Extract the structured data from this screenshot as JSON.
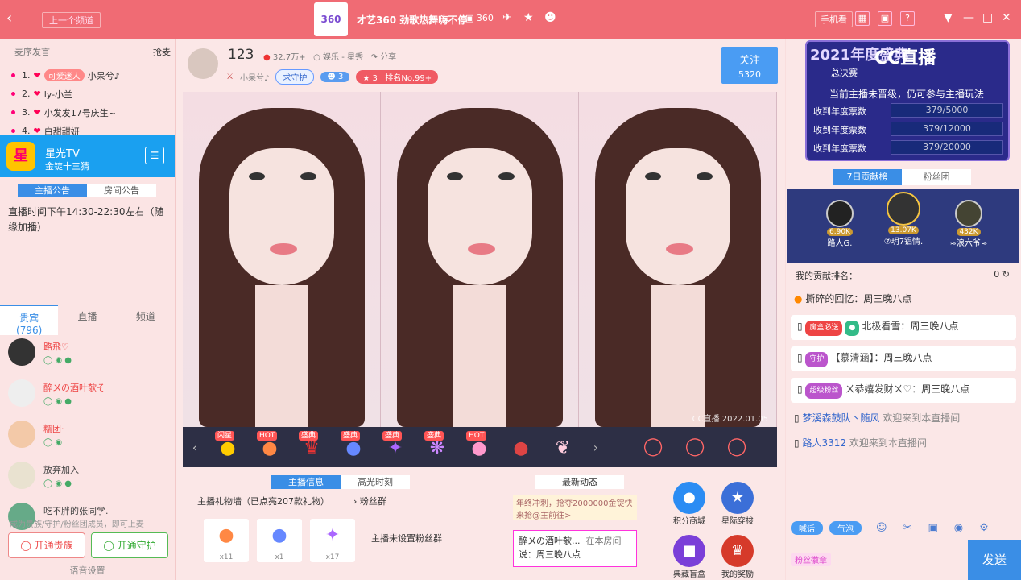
{
  "titlebar": {
    "prev_channel": "上一个频道",
    "logo_text": "360",
    "room_name": "才艺360 劲歌热舞嗨不停",
    "viewers": "360",
    "mobile": "手机看"
  },
  "left": {
    "mic_title": "麦序发言",
    "mic_grab": "抢麦",
    "mic_rows": [
      {
        "num": "1.",
        "tag": "可爱迷人",
        "name": "小呆兮♪"
      },
      {
        "num": "2.",
        "tag": "",
        "name": "ly-小兰"
      },
      {
        "num": "3.",
        "tag": "",
        "name": "小发发17号庆生~"
      },
      {
        "num": "4.",
        "tag": "",
        "name": "白甜甜妍"
      }
    ],
    "banner_logo": "星",
    "banner_name": "星光TV",
    "banner_sub": "金锭十三猜",
    "notice_tab1": "主播公告",
    "notice_tab2": "房间公告",
    "notice_text": "直播时间下午14:30-22:30左右（随缘加播）",
    "tab_guest": "贵宾",
    "tab_guest_count": "(796)",
    "tab_live": "直播",
    "tab_channel": "频道",
    "guests": [
      {
        "name": "路飛♡",
        "vip": true
      },
      {
        "name": "醉〤の酒叶欹そ",
        "vip": true
      },
      {
        "name": "糯团·",
        "vip": true
      },
      {
        "name": "放弃加入",
        "vip": false
      },
      {
        "name": "吃不胖的张同学.",
        "vip": false
      }
    ],
    "hint": "成为贵族/守护/粉丝团成员，即可上麦",
    "btn_noble": "开通贵族",
    "btn_guard": "开通守护",
    "voice": "语音设置"
  },
  "center": {
    "host_name": "123",
    "host_fans": "32.7万+",
    "host_category": "娱乐 - 星秀",
    "share": "分享",
    "host_sub": "小呆兮♪",
    "guard_btn": "求守护",
    "count1": "3",
    "count2": "3",
    "rank": "排名No.99+",
    "follow": "关注",
    "follow_count": "5320",
    "watermark": "CC直播 2022.01.05",
    "gift_tags": [
      "闪星",
      "HOT",
      "盛典",
      "盛典",
      "盛典",
      "盛典",
      "HOT",
      "",
      ""
    ],
    "tab_info": "主播信息",
    "tab_highlight": "高光时刻",
    "gift_wall": "主播礼物墙（已点亮207款礼物）",
    "fan_group": "粉丝群",
    "gift_counts": [
      "x11",
      "x1",
      "x17"
    ],
    "no_fans": "主播未设置粉丝群",
    "news_title": "最新动态",
    "news1": "年终冲刺，抢夺2000000金锭快来抢@主前往>",
    "news2_user": "醉〤の酒叶欹...",
    "news2_where": "在本房间",
    "news2_text": "说：周三晚八点",
    "apps": [
      "积分商城",
      "星际穿梭",
      "典藏盲盒",
      "我的奖励"
    ]
  },
  "right": {
    "year_title": "2021年度盛典",
    "cc_logo": "CC直播",
    "year_sub": "总决赛",
    "year_note": "当前主播未晋级，仍可参与主播玩法",
    "votes": [
      {
        "label": "收到年度票数",
        "value": "379/5000"
      },
      {
        "label": "收到年度票数",
        "value": "379/12000"
      },
      {
        "label": "收到年度票数",
        "value": "379/20000"
      }
    ],
    "tab_rank": "7日贡献榜",
    "tab_fans": "粉丝团",
    "podium": [
      {
        "name": "路人G.",
        "val": "6.90K"
      },
      {
        "name": "⑦玥7铝情.",
        "val": "13.07K"
      },
      {
        "name": "≈浪六爷≈",
        "val": "432K"
      }
    ],
    "my_rank": "我的贡献排名：",
    "my_rank_val": "0",
    "chat": [
      {
        "type": "plain",
        "user": "",
        "text": "撕碎的回忆：周三晚八点"
      },
      {
        "type": "msg",
        "badge": "魔盒必送",
        "user": "北极看雪",
        "text": "：周三晚八点"
      },
      {
        "type": "msg",
        "badge": "守护",
        "user": "【慕清涵】",
        "text": "：周三晚八点"
      },
      {
        "type": "msg",
        "badge": "超级粉丝",
        "user": "ㄨ恭嬉发财ㄨ♡",
        "text": "：周三晚八点"
      },
      {
        "type": "plain",
        "user": "梦溪森鼓队丶随风",
        "text": "欢迎来到本直播间"
      },
      {
        "type": "plain",
        "user": "路人3312",
        "text": "欢迎来到本直播间"
      }
    ],
    "tool_shout": "喊话",
    "tool_bubble": "气泡",
    "fanbadge": "粉丝徽章",
    "send": "发送"
  }
}
